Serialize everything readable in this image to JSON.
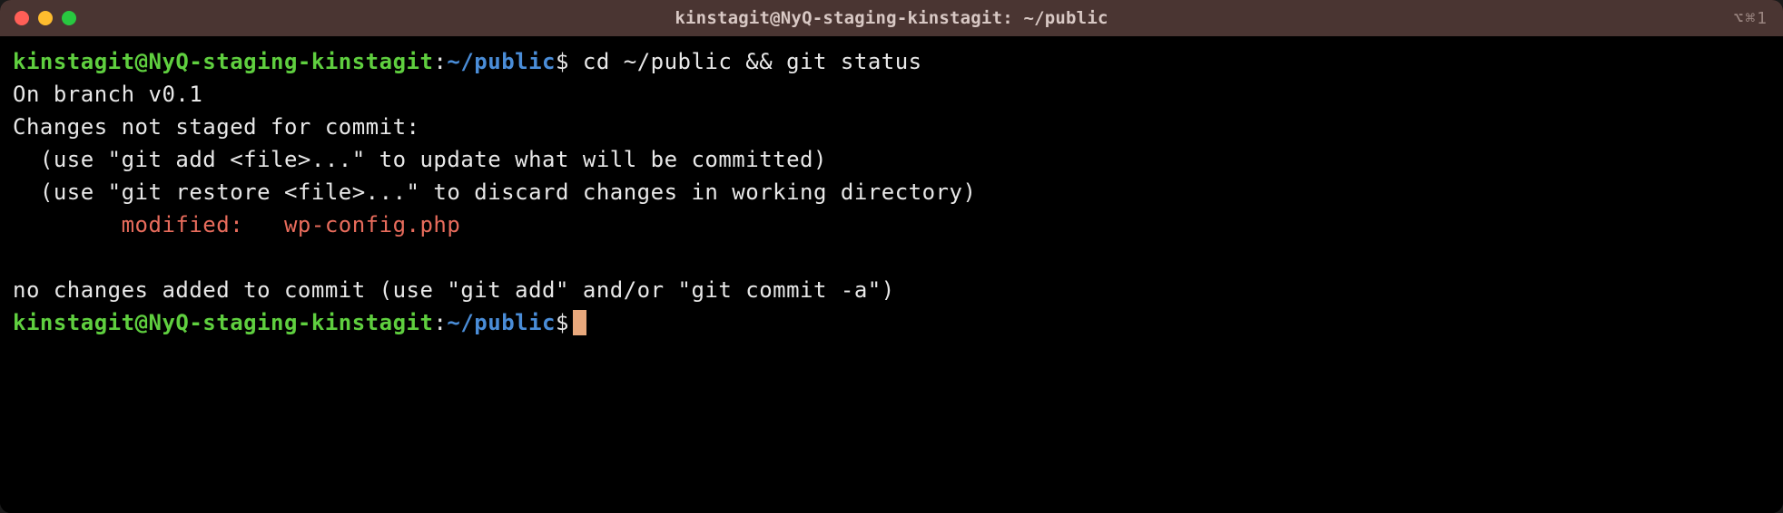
{
  "titlebar": {
    "title": "kinstagit@NyQ-staging-kinstagit: ~/public",
    "shortcut": "⌥⌘1"
  },
  "prompt": {
    "userhost": "kinstagit@NyQ-staging-kinstagit",
    "colon": ":",
    "path": "~/public",
    "symbol": "$"
  },
  "command": "cd ~/public && git status",
  "output": {
    "branch": "On branch v0.1",
    "not_staged_header": "Changes not staged for commit:",
    "hint_add": "  (use \"git add <file>...\" to update what will be committed)",
    "hint_restore": "  (use \"git restore <file>...\" to discard changes in working directory)",
    "modified": "        modified:   wp-config.php",
    "no_changes": "no changes added to commit (use \"git add\" and/or \"git commit -a\")"
  }
}
